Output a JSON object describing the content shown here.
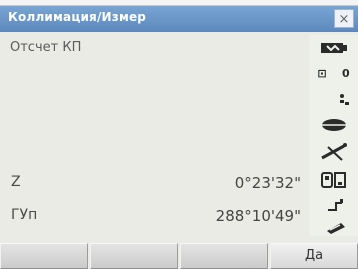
{
  "window": {
    "title": "Коллимация/Измер",
    "close_symbol": "×"
  },
  "content": {
    "mode_label": "Отсчет КП",
    "zenith": {
      "label": "Z",
      "value": "0°23'32\""
    },
    "horizontal": {
      "label": "ГУп",
      "value": "288°10'49\""
    }
  },
  "status_icons": {
    "target_text": "0",
    "icons": [
      "battery-icon",
      "target-icon",
      "compensator-icon",
      "prism-icon",
      "tilt-icon",
      "storage-icon",
      "step-icon",
      "keyboard-icon"
    ]
  },
  "softkeys": {
    "labels": [
      "",
      "",
      "",
      "Да"
    ]
  },
  "colors": {
    "titlebar": "#6f99cb",
    "background": "#e9ebe4",
    "icon": "#2b2b2b"
  }
}
